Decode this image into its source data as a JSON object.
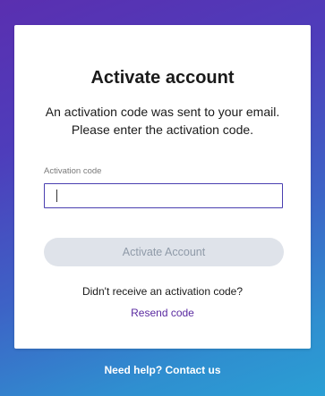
{
  "card": {
    "title": "Activate account",
    "subtitle": "An activation code was sent to your email. Please enter the activation code.",
    "field_label": "Activation code",
    "input_value": "",
    "activate_button": "Activate Account",
    "no_code_text": "Didn't receive an activation code?",
    "resend_link": "Resend code"
  },
  "footer": {
    "help_link": "Need help? Contact us"
  },
  "colors": {
    "accent": "#4a3fb0",
    "link": "#5a2aa0",
    "button_disabled_bg": "#dfe3ea",
    "button_disabled_text": "#8f9aa8"
  }
}
